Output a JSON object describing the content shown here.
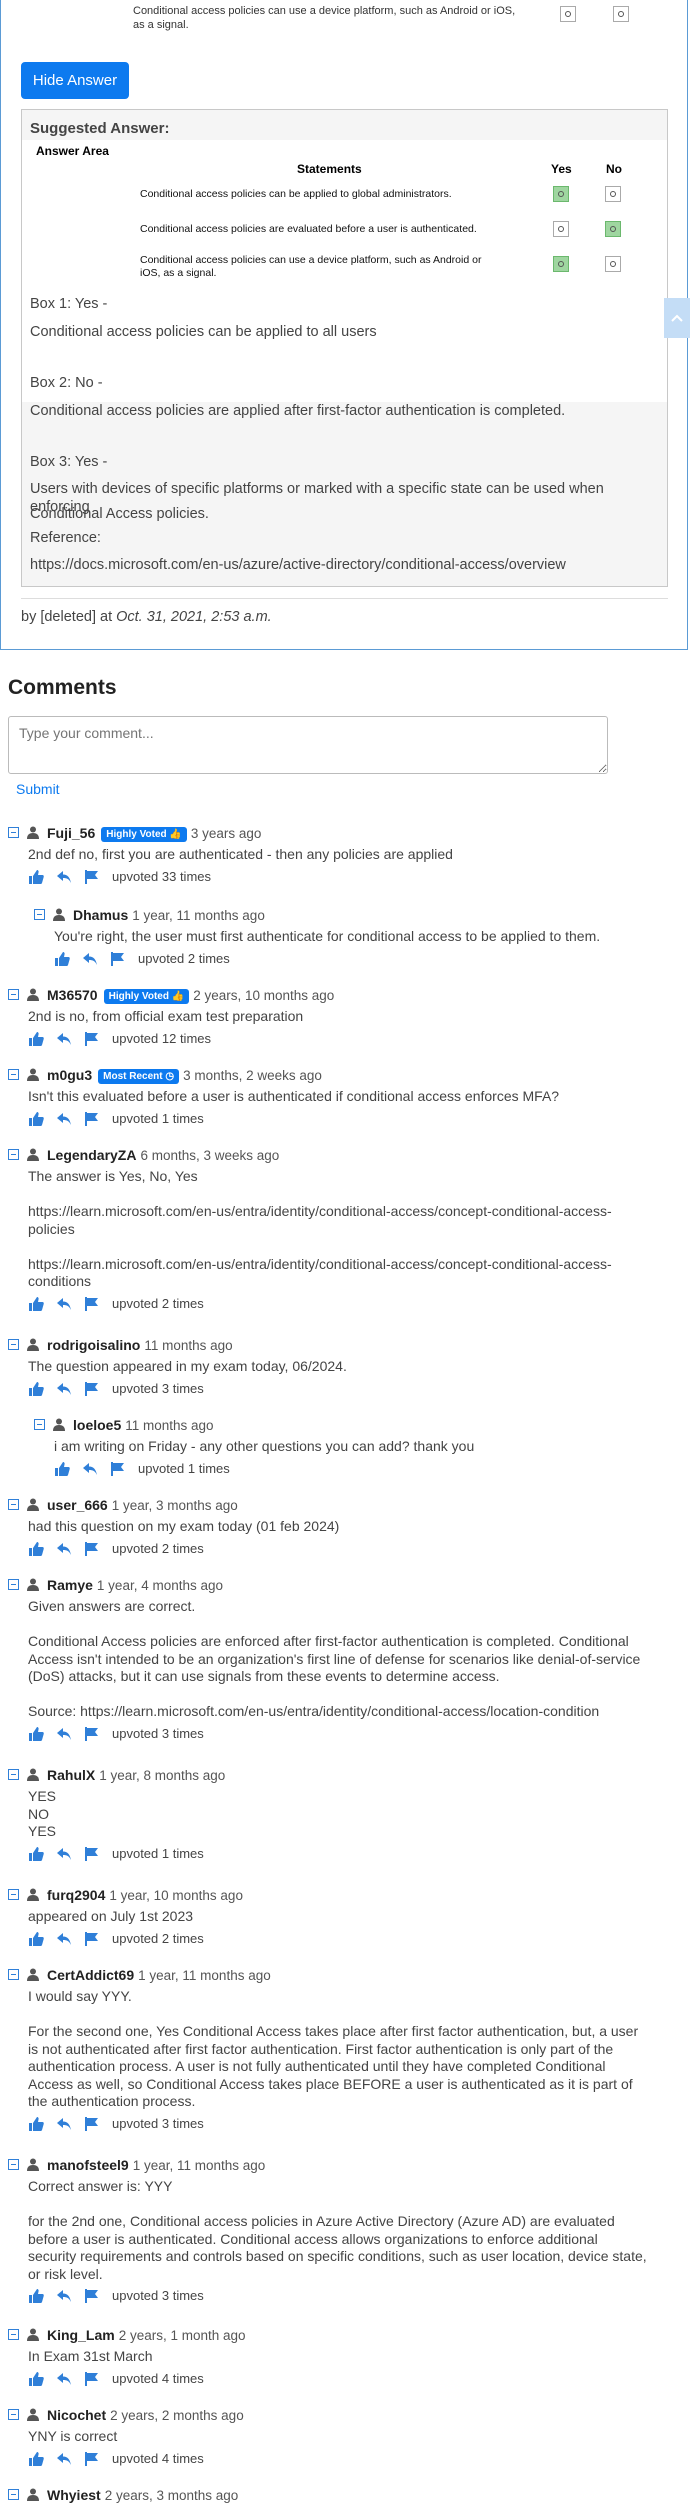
{
  "question_top": {
    "statement": "Conditional access policies can use a device platform, such as Android or iOS, as a signal."
  },
  "hide_answer_label": "Hide Answer",
  "suggested_answer": {
    "title": "Suggested Answer:",
    "answer_area_label": "Answer Area",
    "col_statements": "Statements",
    "col_yes": "Yes",
    "col_no": "No",
    "rows": [
      {
        "statement": "Conditional access policies can be applied to global administrators.",
        "answer": "Yes"
      },
      {
        "statement": "Conditional access policies are evaluated before a user is authenticated.",
        "answer": "No"
      },
      {
        "statement": "Conditional access policies can use a device platform, such as Android or iOS, as a signal.",
        "answer": "Yes"
      }
    ],
    "explanation": [
      "Box 1: Yes -",
      "Conditional access policies can be applied to all users",
      "Box 2: No -",
      "Conditional access policies are applied after first-factor authentication is completed.",
      "Box 3: Yes -",
      "Users with devices of specific platforms or marked with a specific state can be used when enforcing",
      "Conditional Access policies.",
      "Reference:",
      "https://docs.microsoft.com/en-us/azure/active-directory/conditional-access/overview"
    ]
  },
  "byline": {
    "prefix": "by [deleted] at",
    "date": "Oct. 31, 2021, 2:53 a.m."
  },
  "comments_heading": "Comments",
  "comment_placeholder": "Type your comment...",
  "submit_label": "Submit",
  "comments": [
    {
      "user": "Fuji_56",
      "badge": "Highly Voted",
      "time": "3 years ago",
      "text": "2nd def no, first you are authenticated - then any policies are applied",
      "upvotes": "upvoted 33 times"
    },
    {
      "user": "Dhamus",
      "badge": "",
      "time": "1 year, 11 months ago",
      "text": "You're right, the user must first authenticate for conditional access to be applied to them.",
      "upvotes": "upvoted 2 times"
    },
    {
      "user": "M36570",
      "badge": "Highly Voted",
      "time": "2 years, 10 months ago",
      "text": "2nd is no, from official exam test preparation",
      "upvotes": "upvoted 12 times"
    },
    {
      "user": "m0gu3",
      "badge": "Most Recent",
      "time": "3 months, 2 weeks ago",
      "text": "Isn't this evaluated before a user is authenticated if conditional access enforces MFA?",
      "upvotes": "upvoted 1 times"
    },
    {
      "user": "LegendaryZA",
      "badge": "",
      "time": "6 months, 3 weeks ago",
      "text": "The answer is Yes, No, Yes\n\nhttps://learn.microsoft.com/en-us/entra/identity/conditional-access/concept-conditional-access-\npolicies\n\nhttps://learn.microsoft.com/en-us/entra/identity/conditional-access/concept-conditional-access-\nconditions",
      "upvotes": "upvoted 2 times"
    },
    {
      "user": "rodrigoisalino",
      "badge": "",
      "time": "11 months ago",
      "text": "The question appeared in my exam today, 06/2024.",
      "upvotes": "upvoted 3 times"
    },
    {
      "user": "loeloe5",
      "badge": "",
      "time": "11 months ago",
      "text": "i am writing on Friday - any other questions you can add? thank you",
      "upvotes": "upvoted 1 times"
    },
    {
      "user": "user_666",
      "badge": "",
      "time": "1 year, 3 months ago",
      "text": "had this question on my exam today (01 feb 2024)",
      "upvotes": "upvoted 2 times"
    },
    {
      "user": "Ramye",
      "badge": "",
      "time": "1 year, 4 months ago",
      "text": "Given answers are correct.\n\nConditional Access policies are enforced after first-factor authentication is completed. Conditional\nAccess isn't intended to be an organization's first line of defense for scenarios like denial-of-service\n(DoS) attacks, but it can use signals from these events to determine access.\n\nSource: https://learn.microsoft.com/en-us/entra/identity/conditional-access/location-condition",
      "upvotes": "upvoted 3 times"
    },
    {
      "user": "RahulX",
      "badge": "",
      "time": "1 year, 8 months ago",
      "text": "YES\nNO\nYES",
      "upvotes": "upvoted 1 times"
    },
    {
      "user": "furq2904",
      "badge": "",
      "time": "1 year, 10 months ago",
      "text": "appeared on July 1st 2023",
      "upvotes": "upvoted 2 times"
    },
    {
      "user": "CertAddict69",
      "badge": "",
      "time": "1 year, 11 months ago",
      "text": "I would say YYY.\n\nFor the second one, Yes Conditional Access takes place after first factor authentication, but, a user\nis not authenticated after first factor authentication. First factor authentication is only part of the\nauthentication process. A user is not fully authenticated until they have completed Conditional\nAccess as well, so Conditional Access takes place BEFORE a user is authenticated as it is part of\nthe authentication process.",
      "upvotes": "upvoted 3 times"
    },
    {
      "user": "manofsteel9",
      "badge": "",
      "time": "1 year, 11 months ago",
      "text": "Correct answer is: YYY\n\nfor the 2nd one, Conditional access policies in Azure Active Directory (Azure AD) are evaluated\nbefore a user is authenticated. Conditional access allows organizations to enforce additional\nsecurity requirements and controls based on specific conditions, such as user location, device state,\nor risk level.",
      "upvotes": "upvoted 3 times"
    },
    {
      "user": "King_Lam",
      "badge": "",
      "time": "2 years, 1 month ago",
      "text": "In Exam 31st March",
      "upvotes": "upvoted 4 times"
    },
    {
      "user": "Nicochet",
      "badge": "",
      "time": "2 years, 2 months ago",
      "text": "YNY is correct",
      "upvotes": "upvoted 4 times"
    },
    {
      "user": "Whyiest",
      "badge": "",
      "time": "2 years, 3 months ago",
      "text": "",
      "upvotes": ""
    }
  ],
  "colors": {
    "accent": "#0d7aef",
    "selected_radio": "#9fd6a0",
    "card_border": "#5b9bd5"
  },
  "icons": {
    "toggle": "minus-square-icon",
    "user": "user-icon",
    "upvote": "thumbs-up-icon",
    "reply": "reply-icon",
    "report": "flag-icon",
    "scroll": "chevron-up-icon"
  }
}
